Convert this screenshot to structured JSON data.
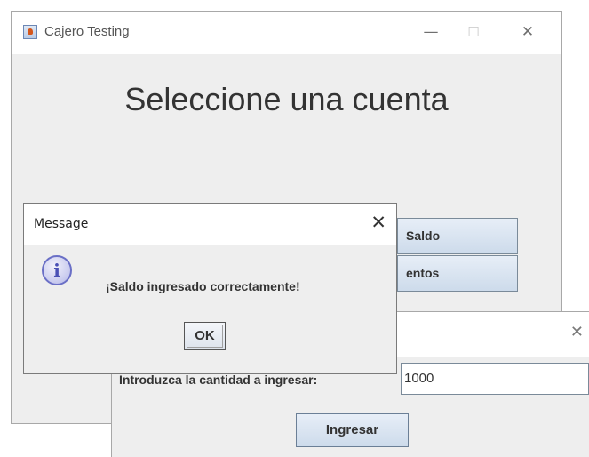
{
  "main_window": {
    "title": "Cajero Testing",
    "minimize_glyph": "—",
    "maximize_glyph": "☐",
    "close_glyph": "✕",
    "heading": "Seleccione una cuenta",
    "buttons": {
      "saldo_label": "Saldo",
      "movimientos_label": "entos"
    }
  },
  "ingresar_dialog": {
    "close_glyph": "✕",
    "amount_label": "Introduzca la cantidad a ingresar:",
    "amount_value": "1000",
    "ingresar_label": "Ingresar"
  },
  "message_dialog": {
    "title": "Message",
    "close_glyph": "✕",
    "icon": "info-icon",
    "icon_glyph": "i",
    "text": "¡Saldo ingresado correctamente!",
    "ok_label": "OK"
  }
}
